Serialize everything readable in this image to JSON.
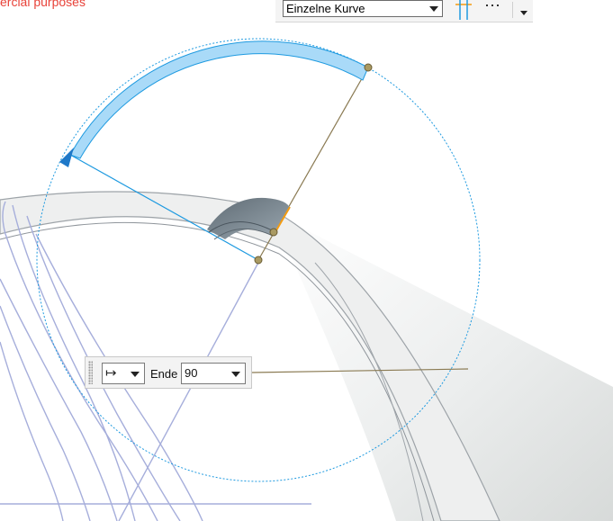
{
  "watermark": {
    "text": "ercial purposes"
  },
  "toolbar": {
    "filter_value": "Einzelne Kurve",
    "snap_icon": "snap-point-icon",
    "more_label": "⋯",
    "dropdown_icon": "chevron-down-icon"
  },
  "dynamic_input": {
    "mode_icon": "end-limit-icon",
    "mode_glyph": "↦",
    "end_label": "Ende",
    "end_value": "90"
  },
  "colors": {
    "rotation_arc_fill": "#a9daf8",
    "rotation_arc_stroke": "#1e9ae0",
    "guide_blue": "#1e9ae0",
    "handle_line": "#8a7a52",
    "edge_lines": "#a6aedb",
    "body_shade": "#e6e8e8",
    "highlight_edge": "#f39c12"
  }
}
